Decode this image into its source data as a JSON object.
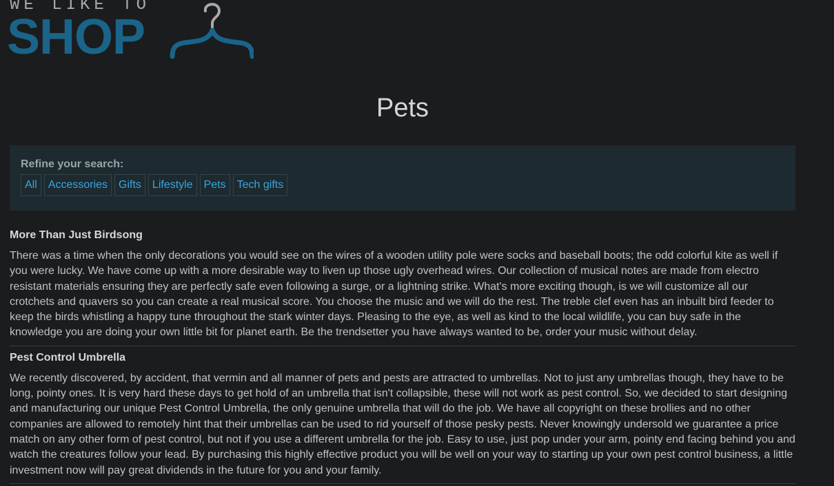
{
  "brand": {
    "tagline": "WE LIKE TO",
    "name": "SHOP",
    "accent_color": "#1a6489"
  },
  "page_title": "Pets",
  "filter": {
    "label": "Refine your search:",
    "categories": [
      "All",
      "Accessories",
      "Gifts",
      "Lifestyle",
      "Pets",
      "Tech gifts"
    ]
  },
  "articles": [
    {
      "title": "More Than Just Birdsong",
      "body": "There was a time when the only decorations you would see on the wires of a wooden utility pole were socks and baseball boots; the odd colorful kite as well if you were lucky. We have come up with a more desirable way to liven up those ugly overhead wires. Our collection of musical notes are made from electro resistant materials ensuring they are perfectly safe even following a surge, or a lightning strike. What's more exciting though, is we will customize all our crotchets and quavers so you can create a real musical score. You choose the music and we will do the rest. The treble clef even has an inbuilt bird feeder to keep the birds whistling a happy tune throughout the stark winter days. Pleasing to the eye, as well as kind to the local wildlife, you can buy safe in the knowledge you are doing your own little bit for planet earth. Be the trendsetter you have always wanted to be, order your music without delay."
    },
    {
      "title": "Pest Control Umbrella",
      "body": "We recently discovered, by accident, that vermin and all manner of pets and pests are attracted to umbrellas. Not to just any umbrellas though, they have to be long, pointy ones. It is very hard these days to get hold of an umbrella that isn't collapsible, these will not work as pest control. So, we decided to start designing and manufacturing our unique Pest Control Umbrella, the only genuine umbrella that will do the job. We have all copyright on these brollies and no other companies are allowed to remotely hint that their umbrellas can be used to rid yourself of those pesky pests. Never knowingly undersold we guarantee a price match on any other form of pest control, but not if you use a different umbrella for the job. Easy to use, just pop under your arm, pointy end facing behind you and watch the creatures follow your lead. By purchasing this highly effective product you will be well on your way to starting up your own pest control business, a little investment now will pay great dividends in the future for you and your family."
    }
  ]
}
